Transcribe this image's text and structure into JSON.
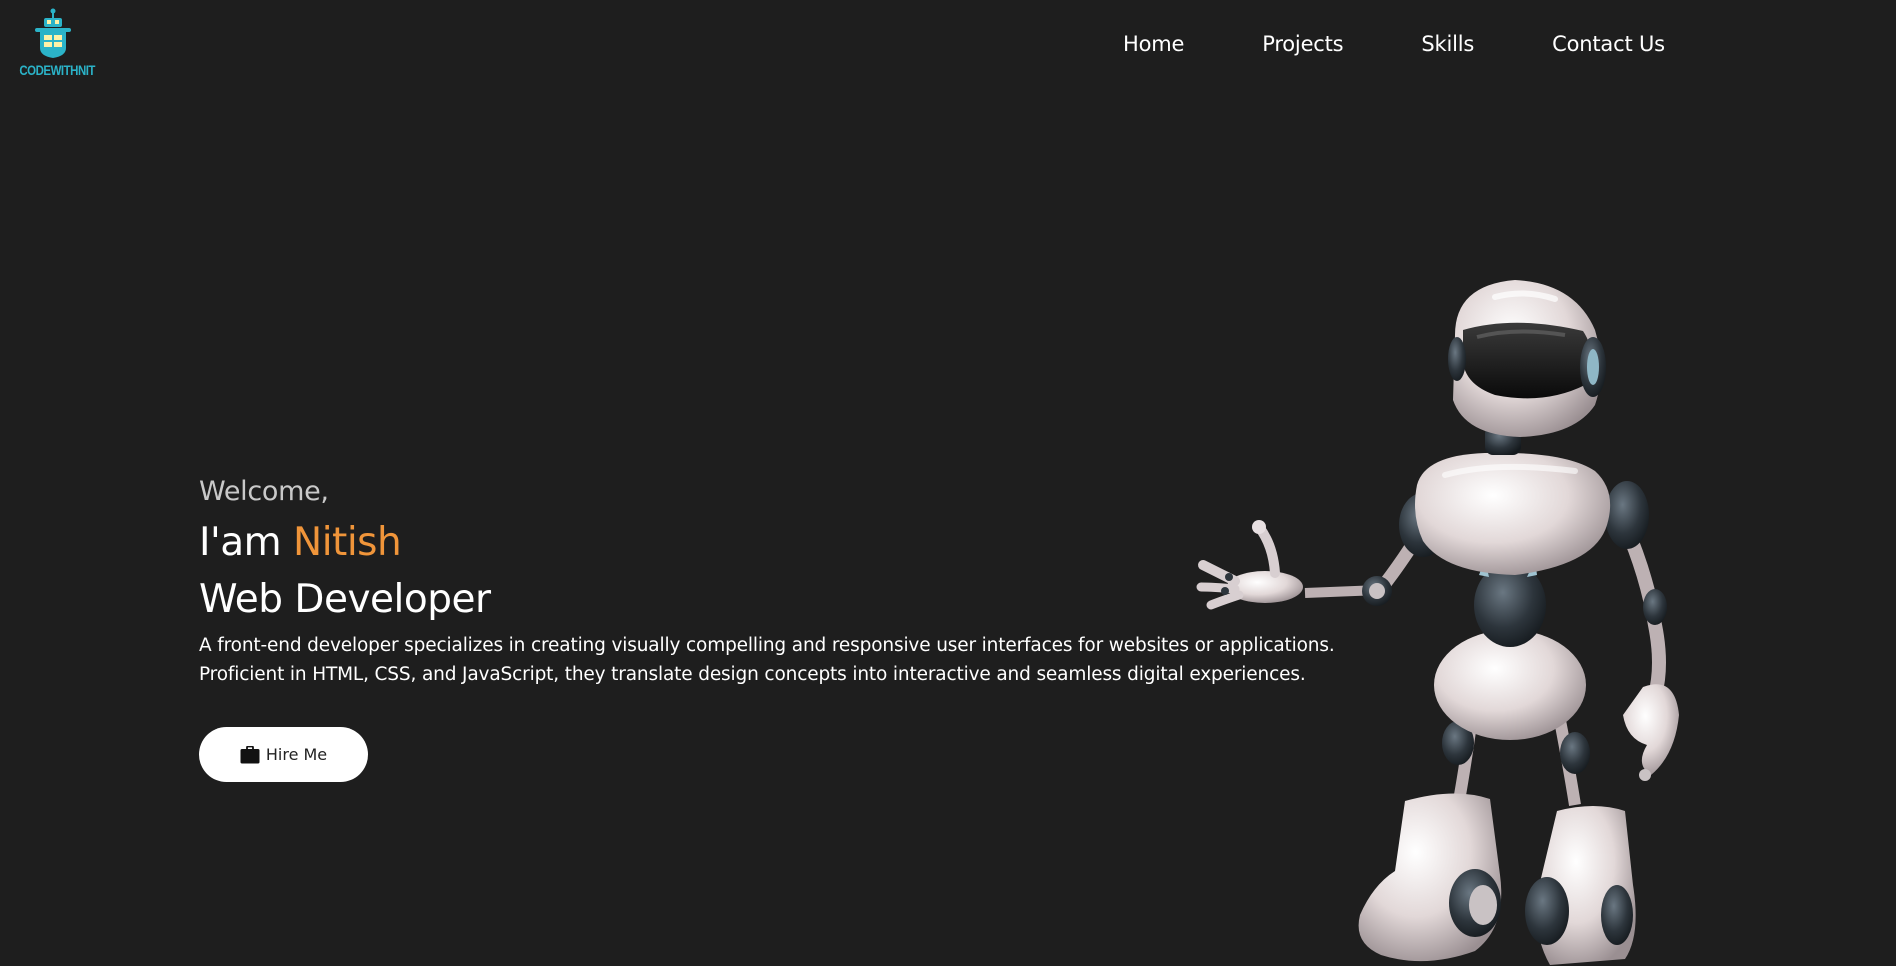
{
  "brand": {
    "logo_text": "CODEWITHNIT",
    "accent_color": "#2bb3c8"
  },
  "nav": {
    "items": [
      {
        "label": "Home"
      },
      {
        "label": "Projects"
      },
      {
        "label": "Skills"
      },
      {
        "label": "Contact Us"
      }
    ]
  },
  "hero": {
    "greeting": "Welcome,",
    "intro_prefix": "I'am ",
    "name": "Nitish",
    "name_color": "#f0953a",
    "role": "Web Developer",
    "description_line1": "A front-end developer specializes in creating visually compelling and responsive user interfaces for websites or applications.",
    "description_line2": "Proficient in HTML, CSS, and JavaScript, they translate design concepts into interactive and seamless digital experiences.",
    "cta_label": "Hire Me",
    "cta_icon": "briefcase-icon"
  },
  "illustration": {
    "subject": "robot-illustration"
  },
  "theme": {
    "background": "#1e1e1e",
    "text": "#ffffff"
  }
}
